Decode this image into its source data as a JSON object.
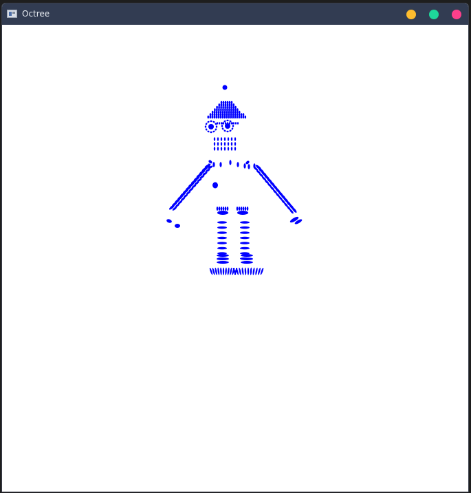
{
  "window": {
    "title": "Octree",
    "icon": "app-window-icon",
    "controls": {
      "minimize_color": "#febd2e",
      "maximize_color": "#1ed79a",
      "close_color": "#fd3f8b"
    }
  },
  "scene": {
    "background_color": "#ffffff",
    "point_color": "#0000ff"
  }
}
